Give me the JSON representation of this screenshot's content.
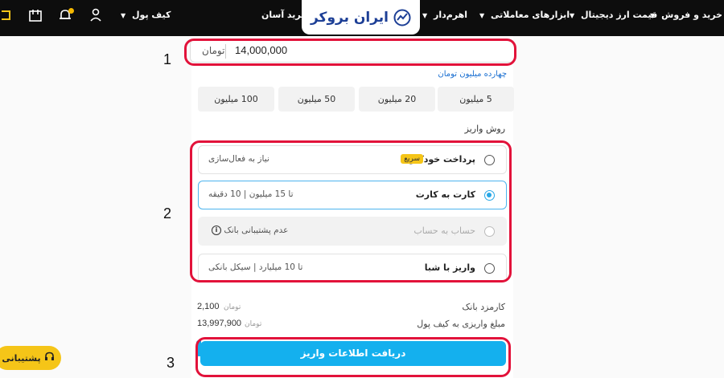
{
  "nav": {
    "items": [
      {
        "label": "خرید و فروش"
      },
      {
        "label": "قیمت ارز دیجیتال"
      },
      {
        "label": "ابزارهای معاملاتی"
      },
      {
        "label": "اهرم‌دار"
      },
      {
        "label": "خرید آسان"
      },
      {
        "label": "کیف پول"
      }
    ],
    "logo_text": "ایران بروکر",
    "icons": [
      "user-icon",
      "bell-icon",
      "wallet-icon",
      "brand-icon"
    ]
  },
  "annotations": [
    "1",
    "2",
    "3"
  ],
  "amount": {
    "value": "14,000,000",
    "unit": "تومان",
    "in_words": "چهارده میلیون تومان"
  },
  "presets": [
    "5 میلیون",
    "20 میلیون",
    "50 میلیون",
    "100 میلیون"
  ],
  "deposit_method": {
    "label": "روش واریز",
    "options": [
      {
        "title": "پرداخت خودکار",
        "badge": "سریع",
        "note": "نیاز به فعال‌سازی",
        "state": "unselected"
      },
      {
        "title": "کارت به کارت",
        "note": "تا 15 میلیون | 10 دقیقه",
        "state": "selected"
      },
      {
        "title": "حساب به حساب",
        "note": "عدم پشتیبانی بانک",
        "state": "disabled"
      },
      {
        "title": "واریز با شبا",
        "note": "تا 10 میلیارد | سیکل بانکی",
        "state": "unselected"
      }
    ]
  },
  "summary": {
    "fee_label": "کارمزد بانک",
    "fee_value": "2,100",
    "fee_unit": "تومان",
    "total_label": "مبلغ واریزی به کیف پول",
    "total_value": "13,997,900",
    "total_unit": "تومان"
  },
  "submit_label": "دریافت اطلاعات واریز",
  "support_label": "پشتیبانی",
  "colors": {
    "accent": "#14b0ee",
    "highlight": "#e2123a",
    "brand_yellow": "#f5c518",
    "topbar": "#0d0d0d"
  }
}
